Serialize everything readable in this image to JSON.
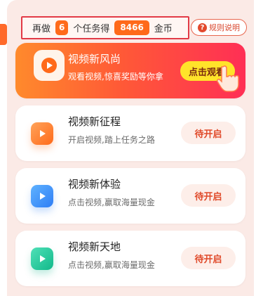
{
  "header": {
    "prefix": "再做",
    "remaining_tasks": "6",
    "middle": "个任务得",
    "coins": "8466",
    "suffix": "金币"
  },
  "rules_button": {
    "label": "规则说明",
    "icon": "question-icon"
  },
  "featured_task": {
    "title": "视频新风尚",
    "subtitle": "观看视频,惊喜奖励等你拿",
    "button_label": "点击观看",
    "icon": "play-icon",
    "hand_icon": "pointing-hand-icon",
    "colors": {
      "gradient_start": "#ff8a2c",
      "gradient_end": "#ff2f55",
      "button": "#ffe32a"
    }
  },
  "tasks": [
    {
      "title": "视频新征程",
      "subtitle": "开启视频,踏上任务之路",
      "button_label": "待开启",
      "icon": "play-icon",
      "icon_color": "#ff7a2a"
    },
    {
      "title": "视频新体验",
      "subtitle": "点击视频,赢取海量现金",
      "button_label": "待开启",
      "icon": "play-icon",
      "icon_color": "#2f8ef5"
    },
    {
      "title": "视频新天地",
      "subtitle": "点击视频,赢取海量现金",
      "button_label": "待开启",
      "icon": "play-icon",
      "icon_color": "#1ec79a"
    }
  ]
}
